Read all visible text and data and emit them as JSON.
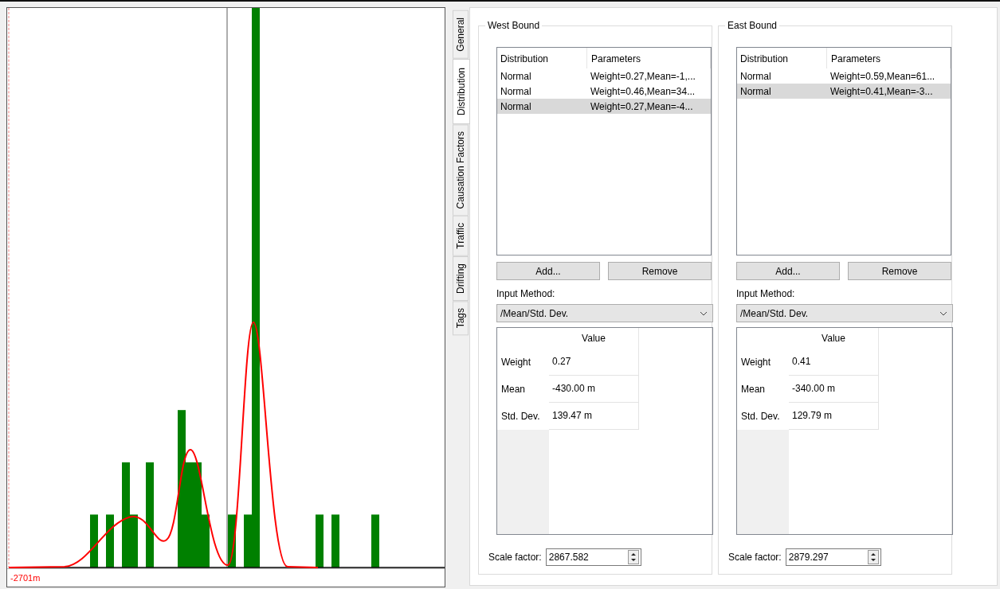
{
  "chart": {
    "axis_label": "-2701m"
  },
  "tabs": [
    {
      "label": "General",
      "selected": false
    },
    {
      "label": "Distribution",
      "selected": true
    },
    {
      "label": "Causation Factors",
      "selected": false
    },
    {
      "label": "Traffic",
      "selected": false
    },
    {
      "label": "Drifting",
      "selected": false
    },
    {
      "label": "Tags",
      "selected": false
    }
  ],
  "groups": [
    {
      "title": "West Bound",
      "columns": [
        "Distribution",
        "Parameters"
      ],
      "rows": [
        {
          "distribution": "Normal",
          "parameters": "Weight=0.27,Mean=-1,...",
          "selected": false
        },
        {
          "distribution": "Normal",
          "parameters": "Weight=0.46,Mean=34...",
          "selected": false
        },
        {
          "distribution": "Normal",
          "parameters": "Weight=0.27,Mean=-4...",
          "selected": true
        }
      ],
      "buttons": [
        "Add...",
        "Remove"
      ],
      "input_method": {
        "label": "Input Method:",
        "value": "/Mean/Std. Dev."
      },
      "grid": {
        "header": "Value",
        "rows": [
          {
            "label": "Weight",
            "value": "0.27"
          },
          {
            "label": "Mean",
            "value": "-430.00 m"
          },
          {
            "label": "Std. Dev.",
            "value": "139.47 m"
          }
        ]
      },
      "scale_factor": {
        "label": "Scale factor:",
        "value": "2867.582"
      }
    },
    {
      "title": "East Bound",
      "columns": [
        "Distribution",
        "Parameters"
      ],
      "rows": [
        {
          "distribution": "Normal",
          "parameters": "Weight=0.59,Mean=61...",
          "selected": false
        },
        {
          "distribution": "Normal",
          "parameters": "Weight=0.41,Mean=-3...",
          "selected": true
        }
      ],
      "buttons": [
        "Add...",
        "Remove"
      ],
      "input_method": {
        "label": "Input Method:",
        "value": "/Mean/Std. Dev."
      },
      "grid": {
        "header": "Value",
        "rows": [
          {
            "label": "Weight",
            "value": "0.41"
          },
          {
            "label": "Mean",
            "value": "-340.00 m"
          },
          {
            "label": "Std. Dev.",
            "value": "129.79 m"
          }
        ]
      },
      "scale_factor": {
        "label": "Scale factor:",
        "value": "2879.297"
      }
    }
  ]
}
